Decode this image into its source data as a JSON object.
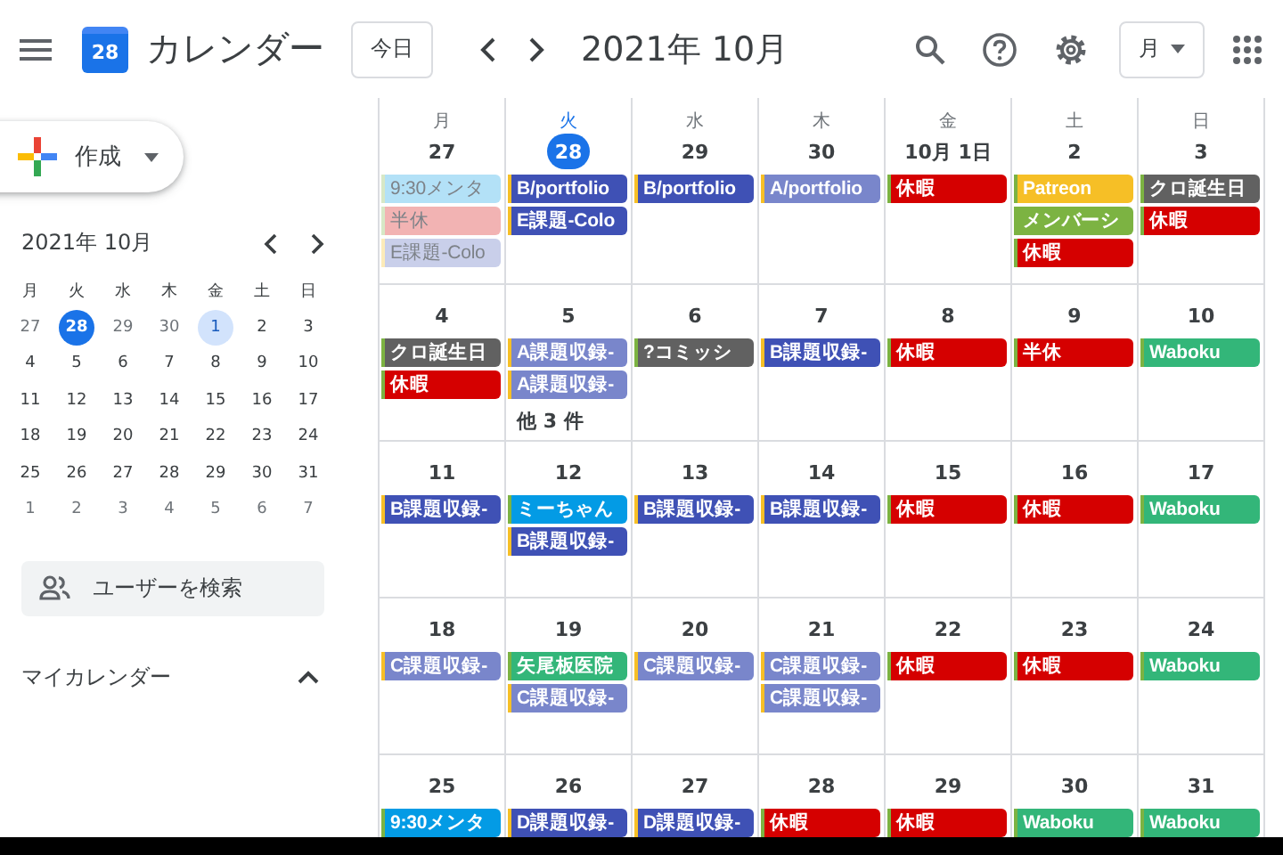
{
  "header": {
    "logo_text": "28",
    "app_name": "カレンダー",
    "today_button": "今日",
    "period": "2021年 10月",
    "view_button": "月"
  },
  "sidebar": {
    "create_button": "作成",
    "mini_calendar": {
      "title": "2021年 10月",
      "weekdays": [
        "月",
        "火",
        "水",
        "木",
        "金",
        "土",
        "日"
      ],
      "days": [
        {
          "label": "27",
          "outside": true,
          "selected": false,
          "focused": false
        },
        {
          "label": "28",
          "outside": true,
          "selected": true,
          "focused": false
        },
        {
          "label": "29",
          "outside": true,
          "selected": false,
          "focused": false
        },
        {
          "label": "30",
          "outside": true,
          "selected": false,
          "focused": false
        },
        {
          "label": "1",
          "outside": false,
          "selected": false,
          "focused": true
        },
        {
          "label": "2",
          "outside": false,
          "selected": false,
          "focused": false
        },
        {
          "label": "3",
          "outside": false,
          "selected": false,
          "focused": false
        },
        {
          "label": "4",
          "outside": false,
          "selected": false,
          "focused": false
        },
        {
          "label": "5",
          "outside": false,
          "selected": false,
          "focused": false
        },
        {
          "label": "6",
          "outside": false,
          "selected": false,
          "focused": false
        },
        {
          "label": "7",
          "outside": false,
          "selected": false,
          "focused": false
        },
        {
          "label": "8",
          "outside": false,
          "selected": false,
          "focused": false
        },
        {
          "label": "9",
          "outside": false,
          "selected": false,
          "focused": false
        },
        {
          "label": "10",
          "outside": false,
          "selected": false,
          "focused": false
        },
        {
          "label": "11",
          "outside": false,
          "selected": false,
          "focused": false
        },
        {
          "label": "12",
          "outside": false,
          "selected": false,
          "focused": false
        },
        {
          "label": "13",
          "outside": false,
          "selected": false,
          "focused": false
        },
        {
          "label": "14",
          "outside": false,
          "selected": false,
          "focused": false
        },
        {
          "label": "15",
          "outside": false,
          "selected": false,
          "focused": false
        },
        {
          "label": "16",
          "outside": false,
          "selected": false,
          "focused": false
        },
        {
          "label": "17",
          "outside": false,
          "selected": false,
          "focused": false
        },
        {
          "label": "18",
          "outside": false,
          "selected": false,
          "focused": false
        },
        {
          "label": "19",
          "outside": false,
          "selected": false,
          "focused": false
        },
        {
          "label": "20",
          "outside": false,
          "selected": false,
          "focused": false
        },
        {
          "label": "21",
          "outside": false,
          "selected": false,
          "focused": false
        },
        {
          "label": "22",
          "outside": false,
          "selected": false,
          "focused": false
        },
        {
          "label": "23",
          "outside": false,
          "selected": false,
          "focused": false
        },
        {
          "label": "24",
          "outside": false,
          "selected": false,
          "focused": false
        },
        {
          "label": "25",
          "outside": false,
          "selected": false,
          "focused": false
        },
        {
          "label": "26",
          "outside": false,
          "selected": false,
          "focused": false
        },
        {
          "label": "27",
          "outside": false,
          "selected": false,
          "focused": false
        },
        {
          "label": "28",
          "outside": false,
          "selected": false,
          "focused": false
        },
        {
          "label": "29",
          "outside": false,
          "selected": false,
          "focused": false
        },
        {
          "label": "30",
          "outside": false,
          "selected": false,
          "focused": false
        },
        {
          "label": "31",
          "outside": false,
          "selected": false,
          "focused": false
        },
        {
          "label": "1",
          "outside": true,
          "selected": false,
          "focused": false
        },
        {
          "label": "2",
          "outside": true,
          "selected": false,
          "focused": false
        },
        {
          "label": "3",
          "outside": true,
          "selected": false,
          "focused": false
        },
        {
          "label": "4",
          "outside": true,
          "selected": false,
          "focused": false
        },
        {
          "label": "5",
          "outside": true,
          "selected": false,
          "focused": false
        },
        {
          "label": "6",
          "outside": true,
          "selected": false,
          "focused": false
        },
        {
          "label": "7",
          "outside": true,
          "selected": false,
          "focused": false
        }
      ]
    },
    "search_people": "ユーザーを検索",
    "my_calendars": "マイカレンダー"
  },
  "month": {
    "weekdays": [
      "月",
      "火",
      "水",
      "木",
      "金",
      "土",
      "日"
    ],
    "weeks": [
      {
        "days": [
          {
            "date": "27",
            "today": false,
            "events": [
              {
                "title": "9:30メンタ",
                "color": "#b3e1f7",
                "calendar": {
                  "color": "#d7e8c6"
                },
                "past": true
              },
              {
                "title": "半休",
                "color": "#f2b3b3",
                "calendar": {
                  "color": "#d7e8c6"
                },
                "past": true
              },
              {
                "title": "E課題-Colo",
                "color": "#c9cfea",
                "calendar": {
                  "color": "#fcebb9"
                },
                "past": true
              }
            ]
          },
          {
            "date": "28",
            "today": true,
            "events": [
              {
                "title": "B/portfolio",
                "color": "#3f51b5",
                "calendar": {
                  "color": "#f6bf26"
                },
                "past": false
              },
              {
                "title": "E課題-Colo",
                "color": "#3f51b5",
                "calendar": {
                  "color": "#f6bf26"
                },
                "past": false
              }
            ]
          },
          {
            "date": "29",
            "today": false,
            "events": [
              {
                "title": "B/portfolio",
                "color": "#3f51b5",
                "calendar": {
                  "color": "#f6bf26"
                },
                "past": false
              }
            ]
          },
          {
            "date": "30",
            "today": false,
            "events": [
              {
                "title": "A/portfolio",
                "color": "#7986cb",
                "calendar": {
                  "color": "#f6bf26"
                },
                "past": false
              }
            ]
          },
          {
            "date": "10月 1日",
            "today": false,
            "events": [
              {
                "title": "休暇",
                "color": "#d50000",
                "calendar": {
                  "color": "#7cb342"
                },
                "past": false
              }
            ]
          },
          {
            "date": "2",
            "today": false,
            "events": [
              {
                "title": "Patreon",
                "color": "#f6bf26",
                "calendar": {
                  "color": "#7cb342"
                },
                "past": false
              },
              {
                "title": "メンバーシ",
                "color": "#7cb342",
                "calendar": {
                  "color": "#7cb342"
                },
                "past": false
              },
              {
                "title": "休暇",
                "color": "#d50000",
                "calendar": {
                  "color": "#7cb342"
                },
                "past": false
              }
            ]
          },
          {
            "date": "3",
            "today": false,
            "events": [
              {
                "title": "クロ誕生日",
                "color": "#616161",
                "calendar": {
                  "color": "#7cb342"
                },
                "past": false
              },
              {
                "title": "休暇",
                "color": "#d50000",
                "calendar": {
                  "color": "#7cb342"
                },
                "past": false
              }
            ]
          }
        ]
      },
      {
        "days": [
          {
            "date": "4",
            "today": false,
            "events": [
              {
                "title": "クロ誕生日",
                "color": "#616161",
                "calendar": {
                  "color": "#7cb342"
                },
                "past": false
              },
              {
                "title": "休暇",
                "color": "#d50000",
                "calendar": {
                  "color": "#7cb342"
                },
                "past": false
              }
            ]
          },
          {
            "date": "5",
            "today": false,
            "events": [
              {
                "title": "A課題収録-",
                "color": "#7986cb",
                "calendar": {
                  "color": "#f6bf26"
                },
                "past": false
              },
              {
                "title": "A課題収録-",
                "color": "#7986cb",
                "calendar": {
                  "color": "#f6bf26"
                },
                "past": false
              }
            ],
            "more": "他 3 件"
          },
          {
            "date": "6",
            "today": false,
            "events": [
              {
                "title": "?コミッシ",
                "color": "#616161",
                "calendar": {
                  "color": "#7cb342"
                },
                "past": false
              }
            ]
          },
          {
            "date": "7",
            "today": false,
            "events": [
              {
                "title": "B課題収録-",
                "color": "#3f51b5",
                "calendar": {
                  "color": "#f6bf26"
                },
                "past": false
              }
            ]
          },
          {
            "date": "8",
            "today": false,
            "events": [
              {
                "title": "休暇",
                "color": "#d50000",
                "calendar": {
                  "color": "#7cb342"
                },
                "past": false
              }
            ]
          },
          {
            "date": "9",
            "today": false,
            "events": [
              {
                "title": "半休",
                "color": "#d50000",
                "calendar": {
                  "color": "#7cb342"
                },
                "past": false
              }
            ]
          },
          {
            "date": "10",
            "today": false,
            "events": [
              {
                "title": "Waboku",
                "color": "#33b679",
                "calendar": {
                  "color": "#7cb342"
                },
                "past": false
              }
            ]
          }
        ]
      },
      {
        "days": [
          {
            "date": "11",
            "today": false,
            "events": [
              {
                "title": "B課題収録-",
                "color": "#3f51b5",
                "calendar": {
                  "color": "#f6bf26"
                },
                "past": false
              }
            ]
          },
          {
            "date": "12",
            "today": false,
            "events": [
              {
                "title": "ミーちゃん",
                "color": "#039be5",
                "calendar": {
                  "color": "#7cb342"
                },
                "past": false
              },
              {
                "title": "B課題収録-",
                "color": "#3f51b5",
                "calendar": {
                  "color": "#f6bf26"
                },
                "past": false
              }
            ]
          },
          {
            "date": "13",
            "today": false,
            "events": [
              {
                "title": "B課題収録-",
                "color": "#3f51b5",
                "calendar": {
                  "color": "#f6bf26"
                },
                "past": false
              }
            ]
          },
          {
            "date": "14",
            "today": false,
            "events": [
              {
                "title": "B課題収録-",
                "color": "#3f51b5",
                "calendar": {
                  "color": "#f6bf26"
                },
                "past": false
              }
            ]
          },
          {
            "date": "15",
            "today": false,
            "events": [
              {
                "title": "休暇",
                "color": "#d50000",
                "calendar": {
                  "color": "#7cb342"
                },
                "past": false
              }
            ]
          },
          {
            "date": "16",
            "today": false,
            "events": [
              {
                "title": "休暇",
                "color": "#d50000",
                "calendar": {
                  "color": "#7cb342"
                },
                "past": false
              }
            ]
          },
          {
            "date": "17",
            "today": false,
            "events": [
              {
                "title": "Waboku",
                "color": "#33b679",
                "calendar": {
                  "color": "#7cb342"
                },
                "past": false
              }
            ]
          }
        ]
      },
      {
        "days": [
          {
            "date": "18",
            "today": false,
            "events": [
              {
                "title": "C課題収録-",
                "color": "#7986cb",
                "calendar": {
                  "color": "#f6bf26"
                },
                "past": false
              }
            ]
          },
          {
            "date": "19",
            "today": false,
            "events": [
              {
                "title": "矢尾板医院",
                "color": "#33b679",
                "calendar": {
                  "color": "#7cb342"
                },
                "past": false
              },
              {
                "title": "C課題収録-",
                "color": "#7986cb",
                "calendar": {
                  "color": "#f6bf26"
                },
                "past": false
              }
            ]
          },
          {
            "date": "20",
            "today": false,
            "events": [
              {
                "title": "C課題収録-",
                "color": "#7986cb",
                "calendar": {
                  "color": "#f6bf26"
                },
                "past": false
              }
            ]
          },
          {
            "date": "21",
            "today": false,
            "events": [
              {
                "title": "C課題収録-",
                "color": "#7986cb",
                "calendar": {
                  "color": "#f6bf26"
                },
                "past": false
              },
              {
                "title": "C課題収録-",
                "color": "#7986cb",
                "calendar": {
                  "color": "#f6bf26"
                },
                "past": false
              }
            ]
          },
          {
            "date": "22",
            "today": false,
            "events": [
              {
                "title": "休暇",
                "color": "#d50000",
                "calendar": {
                  "color": "#7cb342"
                },
                "past": false
              }
            ]
          },
          {
            "date": "23",
            "today": false,
            "events": [
              {
                "title": "休暇",
                "color": "#d50000",
                "calendar": {
                  "color": "#7cb342"
                },
                "past": false
              }
            ]
          },
          {
            "date": "24",
            "today": false,
            "events": [
              {
                "title": "Waboku",
                "color": "#33b679",
                "calendar": {
                  "color": "#7cb342"
                },
                "past": false
              }
            ]
          }
        ]
      },
      {
        "days": [
          {
            "date": "25",
            "today": false,
            "events": [
              {
                "title": "9:30メンタ",
                "color": "#039be5",
                "calendar": {
                  "color": "#7cb342"
                },
                "past": false
              }
            ]
          },
          {
            "date": "26",
            "today": false,
            "events": [
              {
                "title": "D課題収録-",
                "color": "#3f51b5",
                "calendar": {
                  "color": "#f6bf26"
                },
                "past": false
              }
            ]
          },
          {
            "date": "27",
            "today": false,
            "events": [
              {
                "title": "D課題収録-",
                "color": "#3f51b5",
                "calendar": {
                  "color": "#f6bf26"
                },
                "past": false
              }
            ]
          },
          {
            "date": "28",
            "today": false,
            "events": [
              {
                "title": "休暇",
                "color": "#d50000",
                "calendar": {
                  "color": "#7cb342"
                },
                "past": false
              }
            ]
          },
          {
            "date": "29",
            "today": false,
            "events": [
              {
                "title": "休暇",
                "color": "#d50000",
                "calendar": {
                  "color": "#7cb342"
                },
                "past": false
              }
            ]
          },
          {
            "date": "30",
            "today": false,
            "events": [
              {
                "title": "Waboku",
                "color": "#33b679",
                "calendar": {
                  "color": "#7cb342"
                },
                "past": false
              }
            ]
          },
          {
            "date": "31",
            "today": false,
            "events": [
              {
                "title": "Waboku",
                "color": "#33b679",
                "calendar": {
                  "color": "#7cb342"
                },
                "past": false
              }
            ]
          }
        ]
      }
    ]
  }
}
